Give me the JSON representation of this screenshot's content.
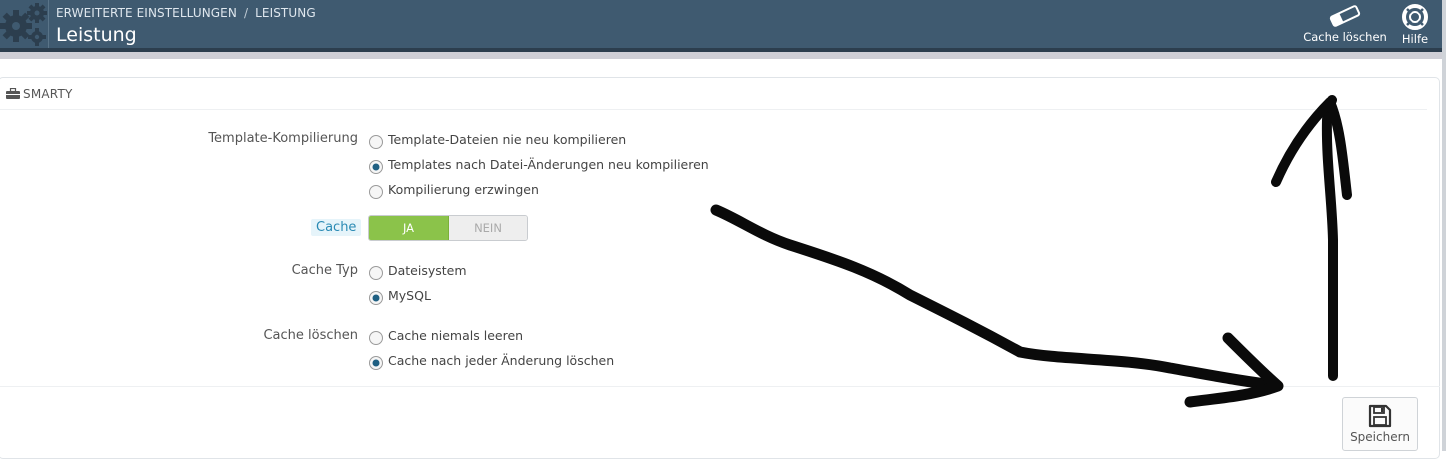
{
  "header": {
    "breadcrumb": [
      "ERWEITERTE EINSTELLUNGEN",
      "LEISTUNG"
    ],
    "breadcrumb_separator": "/",
    "title": "Leistung",
    "background_color": "#3f5a70",
    "toolbar": {
      "cache_clear_label": "Cache löschen",
      "cache_clear_icon": "eraser-icon",
      "help_label": "Hilfe",
      "help_icon": "lifebuoy-icon"
    }
  },
  "panel": {
    "heading": "SMARTY",
    "heading_icon": "briefcase-icon"
  },
  "form": {
    "template_compilation": {
      "label": "Template-Kompilierung",
      "options": [
        {
          "label": "Template-Dateien nie neu kompilieren",
          "selected": false
        },
        {
          "label": "Templates nach Datei-Änderungen neu kompilieren",
          "selected": true
        },
        {
          "label": "Kompilierung erzwingen",
          "selected": false
        }
      ]
    },
    "cache": {
      "label": "Cache",
      "on_label": "JA",
      "off_label": "NEIN",
      "value": true,
      "on_color": "#8bc34a"
    },
    "cache_type": {
      "label": "Cache Typ",
      "options": [
        {
          "label": "Dateisystem",
          "selected": false
        },
        {
          "label": "MySQL",
          "selected": true
        }
      ]
    },
    "cache_clear": {
      "label": "Cache löschen",
      "options": [
        {
          "label": "Cache niemals leeren",
          "selected": false
        },
        {
          "label": "Cache nach jeder Änderung löschen",
          "selected": true
        }
      ]
    }
  },
  "footer": {
    "save_label": "Speichern",
    "save_icon": "floppy-disk-icon"
  }
}
